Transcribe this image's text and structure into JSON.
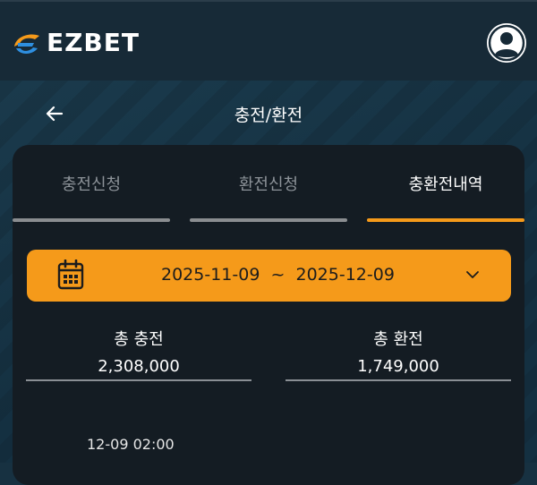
{
  "brand": {
    "name": "EZBET"
  },
  "header": {
    "title": "충전/환전",
    "back_icon": "arrow-left-icon"
  },
  "tabs": [
    {
      "label": "충전신청",
      "active": false
    },
    {
      "label": "환전신청",
      "active": false
    },
    {
      "label": "충환전내역",
      "active": true
    }
  ],
  "date_filter": {
    "start": "2025-11-09",
    "separator": "~",
    "end": "2025-12-09",
    "display": "2025-11-09  ~  2025-12-09"
  },
  "summary": {
    "deposit_label": "총 충전",
    "deposit_value": "2,308,000",
    "withdraw_label": "총 환전",
    "withdraw_value": "1,749,000"
  },
  "entries": [
    {
      "time": "12-09 02:00"
    }
  ],
  "colors": {
    "accent": "#f59a1a",
    "panel": "#141c23",
    "topbar": "#172a37",
    "inactive_tab_text": "#8d9399",
    "inactive_tab_bar": "#8a8d90"
  }
}
